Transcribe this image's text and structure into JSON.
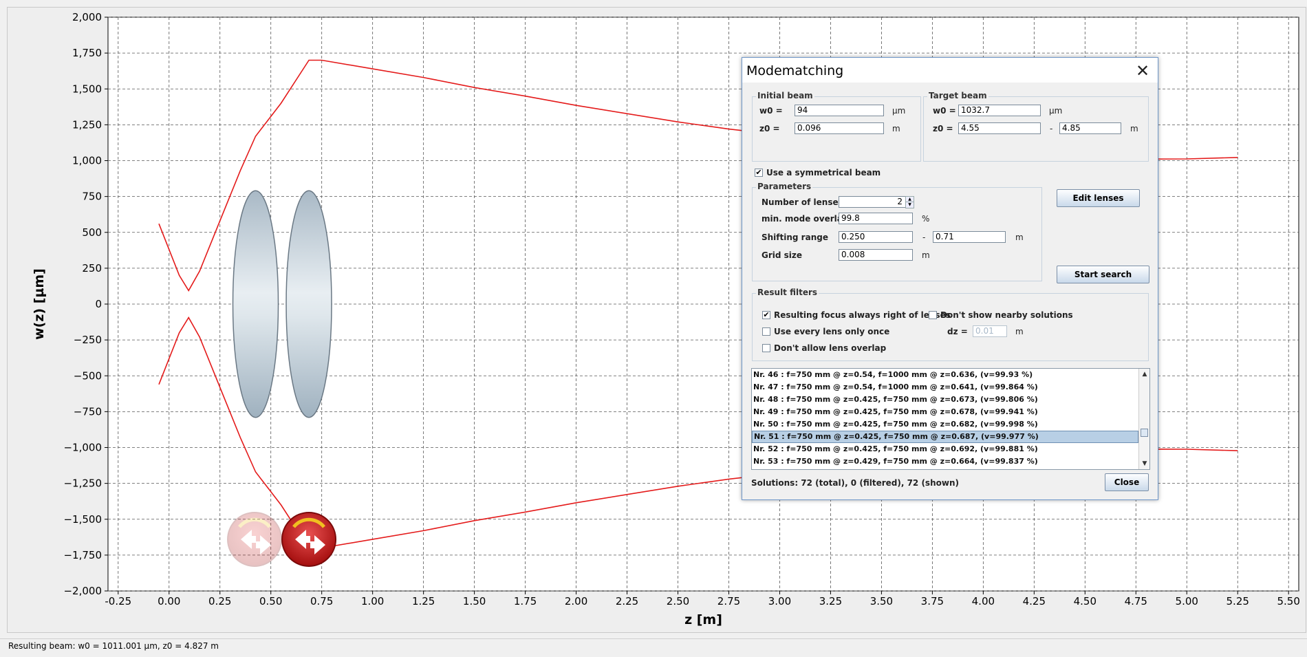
{
  "chart_data": {
    "type": "line",
    "xlabel": "z [m]",
    "ylabel": "w(z) [µm]",
    "xlim": [
      -0.3,
      5.55
    ],
    "ylim": [
      -2000,
      2000
    ],
    "xticks": [
      -0.25,
      0,
      0.25,
      0.5,
      0.75,
      1,
      1.25,
      1.5,
      1.75,
      2,
      2.25,
      2.5,
      2.75,
      3,
      3.25,
      3.5,
      3.75,
      4,
      4.25,
      4.5,
      4.75,
      5,
      5.25,
      5.5
    ],
    "xtick_labels": [
      "-0.25",
      "0.00",
      "0.25",
      "0.50",
      "0.75",
      "1.00",
      "1.25",
      "1.50",
      "1.75",
      "2.00",
      "2.25",
      "2.50",
      "2.75",
      "3.00",
      "3.25",
      "3.50",
      "3.75",
      "4.00",
      "4.25",
      "4.50",
      "4.75",
      "5.00",
      "5.25",
      "5.50"
    ],
    "yticks": [
      2000,
      1750,
      1500,
      1250,
      1000,
      750,
      500,
      250,
      0,
      -250,
      -500,
      -750,
      -1000,
      -1250,
      -1500,
      -1750,
      -2000
    ],
    "ytick_labels": [
      "2,000",
      "1,750",
      "1,500",
      "1,250",
      "1,000",
      "750",
      "500",
      "250",
      "0",
      "−250",
      "−500",
      "−750",
      "−1,000",
      "−1,250",
      "−1,500",
      "−1,750",
      "−2,000"
    ],
    "grid": true,
    "series": [
      {
        "color": "#e41a1a",
        "points": [
          [
            -0.05,
            560
          ],
          [
            0.05,
            200
          ],
          [
            0.096,
            94
          ],
          [
            0.15,
            230
          ],
          [
            0.25,
            580
          ],
          [
            0.35,
            930
          ],
          [
            0.425,
            1170
          ],
          [
            0.55,
            1400
          ],
          [
            0.687,
            1700
          ],
          [
            0.75,
            1700
          ],
          [
            1.0,
            1640
          ],
          [
            1.25,
            1580
          ],
          [
            1.5,
            1510
          ],
          [
            1.75,
            1450
          ],
          [
            2.0,
            1385
          ],
          [
            2.5,
            1270
          ],
          [
            2.75,
            1220
          ],
          [
            3.0,
            1180
          ],
          [
            3.25,
            1140
          ],
          [
            3.5,
            1100
          ],
          [
            4.0,
            1060
          ],
          [
            4.5,
            1030
          ],
          [
            4.827,
            1011
          ],
          [
            5.0,
            1012
          ],
          [
            5.25,
            1022
          ]
        ]
      },
      {
        "color": "#e41a1a",
        "points": [
          [
            -0.05,
            -560
          ],
          [
            0.05,
            -200
          ],
          [
            0.096,
            -94
          ],
          [
            0.15,
            -230
          ],
          [
            0.25,
            -580
          ],
          [
            0.35,
            -930
          ],
          [
            0.425,
            -1170
          ],
          [
            0.55,
            -1400
          ],
          [
            0.687,
            -1700
          ],
          [
            0.75,
            -1700
          ],
          [
            1.0,
            -1640
          ],
          [
            1.25,
            -1580
          ],
          [
            1.5,
            -1510
          ],
          [
            1.75,
            -1450
          ],
          [
            2.0,
            -1385
          ],
          [
            2.5,
            -1270
          ],
          [
            2.75,
            -1220
          ],
          [
            3.0,
            -1180
          ],
          [
            3.25,
            -1140
          ],
          [
            3.5,
            -1100
          ],
          [
            4.0,
            -1060
          ],
          [
            4.5,
            -1030
          ],
          [
            4.827,
            -1011
          ],
          [
            5.0,
            -1012
          ],
          [
            5.25,
            -1022
          ]
        ]
      }
    ],
    "lenses": [
      {
        "z": 0.425,
        "half_height": 790
      },
      {
        "z": 0.687,
        "half_height": 790
      }
    ],
    "lens_handles": [
      {
        "z": 0.42,
        "w": -1640,
        "state": "faded"
      },
      {
        "z": 0.687,
        "w": -1640,
        "state": "active"
      }
    ]
  },
  "status_bar": {
    "text": "Resulting beam: w0 = 1011.001 µm, z0 = 4.827 m"
  },
  "dialog": {
    "title": "Modematching",
    "close_glyph": "✕",
    "initial_beam": {
      "title": "Initial beam",
      "w0_label": "w0 =",
      "w0_value": "94",
      "w0_unit": "µm",
      "z0_label": "z0 =",
      "z0_value": "0.096",
      "z0_unit": "m"
    },
    "target_beam": {
      "title": "Target beam",
      "w0_label": "w0 =",
      "w0_value": "1032.7",
      "w0_unit": "µm",
      "z0_label": "z0 =",
      "z0_from": "4.55",
      "dash": "-",
      "z0_to": "4.85",
      "z0_unit": "m"
    },
    "symmetric": {
      "label": "Use a symmetrical beam",
      "checked": true
    },
    "parameters": {
      "title": "Parameters",
      "num_lenses_label": "Number of lenses",
      "num_lenses_value": "2",
      "overlap_label": "min. mode overlap",
      "overlap_value": "99.8",
      "overlap_unit": "%",
      "shift_label": "Shifting range",
      "shift_from": "0.250",
      "dash": "-",
      "shift_to": "0.71",
      "shift_unit": "m",
      "grid_label": "Grid size",
      "grid_value": "0.008",
      "grid_unit": "m"
    },
    "edit_lenses_label": "Edit lenses",
    "start_search_label": "Start search",
    "filters": {
      "title": "Result filters",
      "focus_right": {
        "label": "Resulting focus always right of lenses",
        "checked": true
      },
      "no_nearby": {
        "label": "Don't show nearby solutions",
        "checked": false
      },
      "every_once": {
        "label": "Use every lens only once",
        "checked": false
      },
      "no_overlap": {
        "label": "Don't allow lens overlap",
        "checked": false
      },
      "dz_label": "dz =",
      "dz_value": "0.01",
      "dz_unit": "m"
    },
    "results": [
      "Nr. 46 : f=750 mm @ z=0.54, f=1000 mm @ z=0.636,  (v=99.93 %)",
      "Nr. 47 : f=750 mm @ z=0.54, f=1000 mm @ z=0.641,  (v=99.864 %)",
      "Nr. 48 : f=750 mm @ z=0.425, f=750 mm @ z=0.673,  (v=99.806 %)",
      "Nr. 49 : f=750 mm @ z=0.425, f=750 mm @ z=0.678,  (v=99.941 %)",
      "Nr. 50 : f=750 mm @ z=0.425, f=750 mm @ z=0.682,  (v=99.998 %)",
      "Nr. 51 : f=750 mm @ z=0.425, f=750 mm @ z=0.687,  (v=99.977 %)",
      "Nr. 52 : f=750 mm @ z=0.425, f=750 mm @ z=0.692,  (v=99.881 %)",
      "Nr. 53 : f=750 mm @ z=0.429, f=750 mm @ z=0.664,  (v=99.837 %)"
    ],
    "selected_index": 5,
    "solutions_text": "Solutions: 72 (total), 0 (filtered), 72 (shown)",
    "close_label": "Close"
  }
}
